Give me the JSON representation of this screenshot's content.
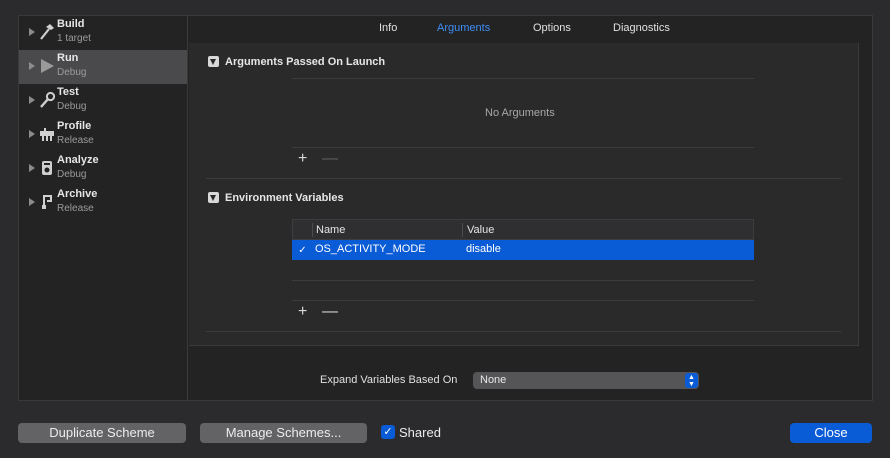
{
  "sidebar": {
    "items": [
      {
        "name": "Build",
        "sub": "1 target",
        "icon": "hammer-icon"
      },
      {
        "name": "Run",
        "sub": "Debug",
        "icon": "play-icon"
      },
      {
        "name": "Test",
        "sub": "Debug",
        "icon": "wrench-icon"
      },
      {
        "name": "Profile",
        "sub": "Release",
        "icon": "gauge-icon"
      },
      {
        "name": "Analyze",
        "sub": "Debug",
        "icon": "analyze-icon"
      },
      {
        "name": "Archive",
        "sub": "Release",
        "icon": "archive-icon"
      }
    ],
    "selected": "Run"
  },
  "tabs": [
    "Info",
    "Arguments",
    "Options",
    "Diagnostics"
  ],
  "active_tab": "Arguments",
  "arguments": {
    "title": "Arguments Passed On Launch",
    "empty_text": "No Arguments",
    "add": "+",
    "remove": "—"
  },
  "environment": {
    "title": "Environment Variables",
    "columns": [
      "Name",
      "Value"
    ],
    "rows": [
      {
        "checked": true,
        "name": "OS_ACTIVITY_MODE",
        "value": "disable"
      }
    ],
    "add": "+",
    "remove": "—"
  },
  "expand": {
    "label": "Expand Variables Based On",
    "value": "None"
  },
  "buttons": {
    "duplicate": "Duplicate Scheme",
    "manage": "Manage Schemes...",
    "shared_label": "Shared",
    "shared_checked": true,
    "close": "Close"
  },
  "colors": {
    "accent": "#0a5bd6",
    "tab_active": "#3e8ef7",
    "background": "#2b2b2d"
  }
}
